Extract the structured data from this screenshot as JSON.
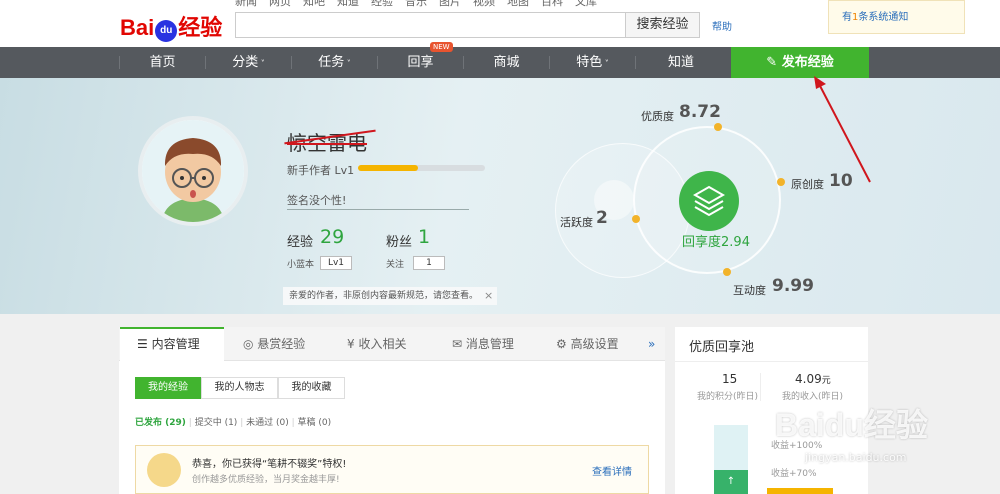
{
  "header": {
    "logo_left": "Bai",
    "logo_paw": "du",
    "logo_right": "经验",
    "top_links": [
      "新闻",
      "网页",
      "知吧",
      "知道",
      "经验",
      "音乐",
      "图片",
      "视频",
      "地图",
      "百科",
      "文库"
    ],
    "search_button": "搜索经验",
    "help": "帮助",
    "notify_prefix": "有",
    "notify_count": "1",
    "notify_suffix": "条系统通知"
  },
  "nav": {
    "items": [
      "首页",
      "分类",
      "任务",
      "回享",
      "商城",
      "特色",
      "知道"
    ],
    "new_badge": "NEW",
    "publish": "发布经验"
  },
  "profile": {
    "username": "惊空雷电",
    "level_label": "新手作者 Lv1",
    "level_progress": 0.47,
    "signature": "签名没个性!",
    "exp_label": "经验",
    "exp_value": "29",
    "fans_label": "粉丝",
    "fans_value": "1",
    "blue_label": "小蓝本",
    "blue_chip": "Lv1",
    "follow_label": "关注",
    "follow_chip": "1",
    "notice": "亲爱的作者，非原创内容最新规范，请您查看。",
    "notice_close": "×"
  },
  "stats": {
    "quality_label": "优质度",
    "quality_value": "8.72",
    "original_label": "原创度",
    "original_value": "10",
    "active_label": "活跃度",
    "active_value": "2",
    "interact_label": "互动度",
    "interact_value": "9.99",
    "center_label": "回享度",
    "center_value": "2.94"
  },
  "panel": {
    "tabs": [
      "内容管理",
      "悬赏经验",
      "收入相关",
      "消息管理",
      "高级设置"
    ],
    "more": "»",
    "subtabs": [
      "我的经验",
      "我的人物志",
      "我的收藏"
    ],
    "filters": {
      "published": "已发布",
      "published_count": "(29)",
      "pending": "提交中 (1)",
      "rejected": "未通过 (0)",
      "draft": "草稿 (0)"
    },
    "award_title": "恭喜，你已获得“笔耕不辍奖”特权!",
    "award_sub": "创作越多优质经验，当月奖金越丰厚!",
    "award_link": "查看详情"
  },
  "pool": {
    "title": "优质回享池",
    "points_value": "15",
    "points_label": "我的积分(昨日)",
    "income_value": "4.09",
    "income_unit": "元",
    "income_label": "我的收入(昨日)",
    "bar_label1": "收益+100%",
    "bar_label2": "收益+70%"
  },
  "watermark": {
    "text": "Baidu经验",
    "url": "jingyan.baidu.com"
  },
  "colors": {
    "green": "#41b42f",
    "nav": "#55595e",
    "orange": "#f5b400",
    "red_arrow": "#d0161d"
  }
}
